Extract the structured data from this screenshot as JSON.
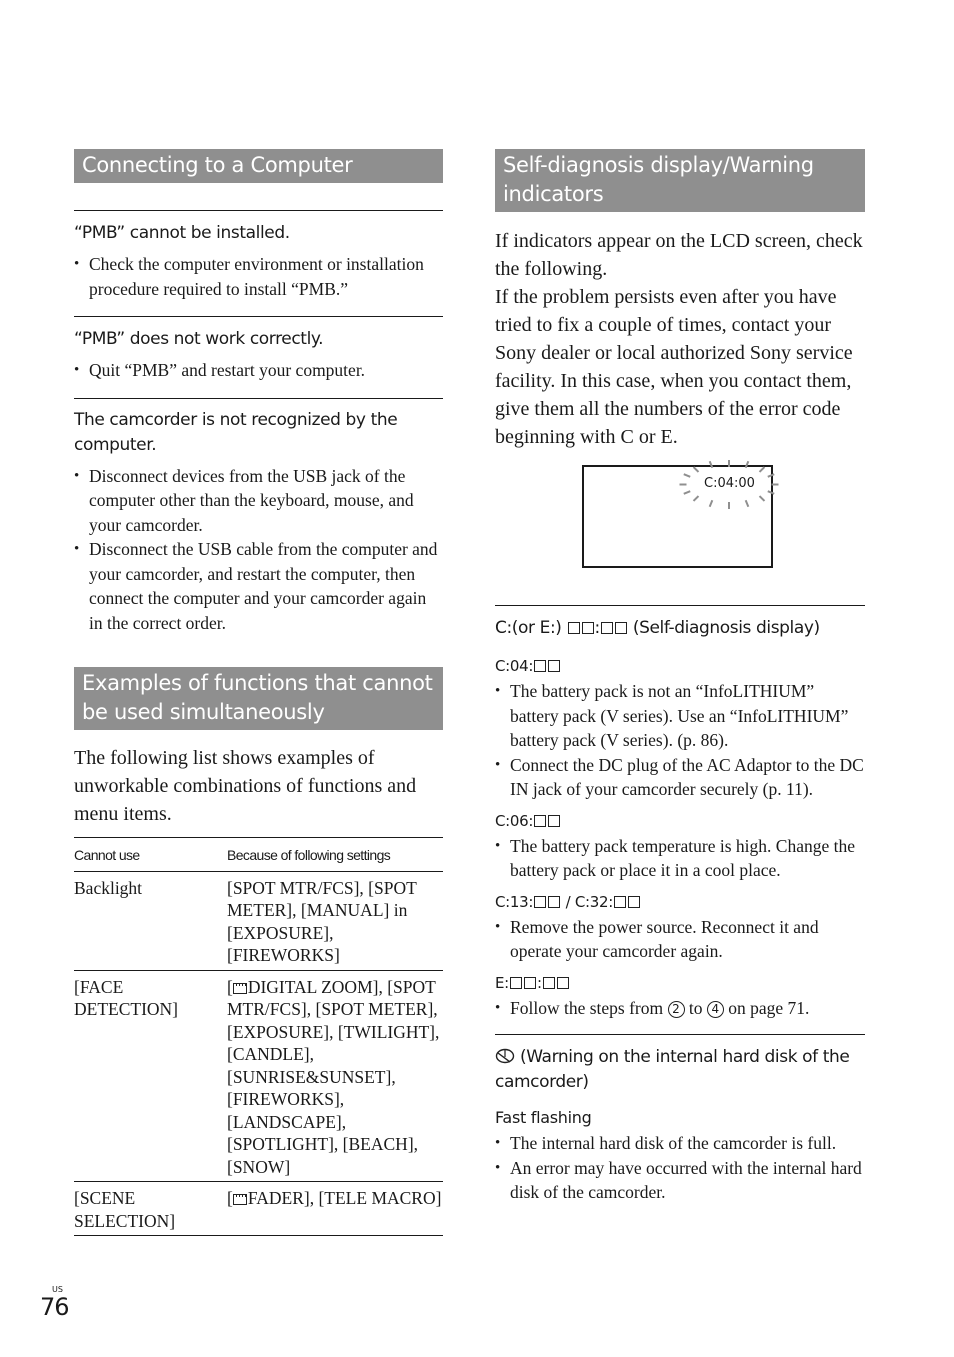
{
  "left": {
    "section1": {
      "title": "Connecting to a Computer",
      "items": [
        {
          "title": "“PMB” cannot be installed.",
          "bullets": [
            "Check the computer environment or installation procedure required to install “PMB.”"
          ]
        },
        {
          "title": "“PMB” does not work correctly.",
          "bullets": [
            "Quit “PMB” and restart your computer."
          ]
        },
        {
          "title": "The camcorder is not recognized by the computer.",
          "bullets": [
            "Disconnect devices from the USB jack of the computer other than the keyboard, mouse, and your camcorder.",
            "Disconnect the USB cable from the computer and your camcorder, and restart the computer, then connect the computer and your camcorder again in the correct order."
          ]
        }
      ]
    },
    "section2": {
      "title": "Examples of functions that cannot be used simultaneously",
      "intro": "The following list shows examples of unworkable combinations of functions and menu items.",
      "table": {
        "headers": [
          "Cannot use",
          "Because of following settings"
        ],
        "rows": [
          {
            "cannot_use": "Backlight",
            "settings": "[SPOT MTR/FCS], [SPOT METER], [MANUAL] in [EXPOSURE], [FIREWORKS]"
          },
          {
            "cannot_use": "[FACE DETECTION]",
            "settings_prefix": "[",
            "settings_icon": "movie-film-icon",
            "settings": "DIGITAL ZOOM], [SPOT MTR/FCS], [SPOT METER], [EXPOSURE], [TWILIGHT], [CANDLE], [SUNRISE&SUNSET], [FIREWORKS], [LANDSCAPE], [SPOTLIGHT], [BEACH], [SNOW]"
          },
          {
            "cannot_use": "[SCENE SELECTION]",
            "settings_prefix": "[",
            "settings_icon": "movie-film-icon",
            "settings": "FADER], [TELE MACRO]"
          }
        ]
      }
    }
  },
  "right": {
    "section": {
      "title": "Self-diagnosis display/Warning indicators",
      "intro": "If indicators appear on the LCD screen, check the following.",
      "intro2": "If the problem persists even after you have tried to fix a couple of times, contact your Sony dealer or local authorized Sony service facility. In this case, when you contact them, give them all the numbers of the error code beginning with C or E.",
      "lcd_code": "C:04:00",
      "self_diag": {
        "title_prefix": "C:(or E:) ",
        "title_suffix": " (Self-diagnosis display)",
        "codes": [
          {
            "code_prefix": "C:04:",
            "boxes_after": 2,
            "bullets": [
              "The battery pack is not an “InfoLITHIUM” battery pack (V series). Use an “InfoLITHIUM” battery pack (V series). (p. 86).",
              "Connect the DC plug of the AC Adaptor to the DC IN jack of your camcorder securely (p. 11)."
            ]
          },
          {
            "code_prefix": "C:06:",
            "boxes_after": 2,
            "bullets": [
              "The battery pack temperature is high. Change the battery pack or place it in a cool place."
            ]
          },
          {
            "code_prefix": "C:13:",
            "code_mid": " / C:32:",
            "bullets": [
              "Remove the power source. Reconnect it and operate your camcorder again."
            ]
          },
          {
            "code_prefix": "E:",
            "bullets_rich": {
              "pre": "Follow the steps from ",
              "n1": "2",
              "mid": " to ",
              "n2": "4",
              "post": " on page 71."
            }
          }
        ]
      },
      "hdd_warning": {
        "icon": "hard-disk-warning-icon",
        "title": " (Warning on the internal hard disk of the camcorder)",
        "subtitle": "Fast flashing",
        "bullets": [
          "The internal hard disk of the camcorder is full.",
          "An error may have occurred with the internal hard disk of the camcorder."
        ]
      }
    }
  },
  "footer": {
    "region": "US",
    "page_number": "76"
  }
}
